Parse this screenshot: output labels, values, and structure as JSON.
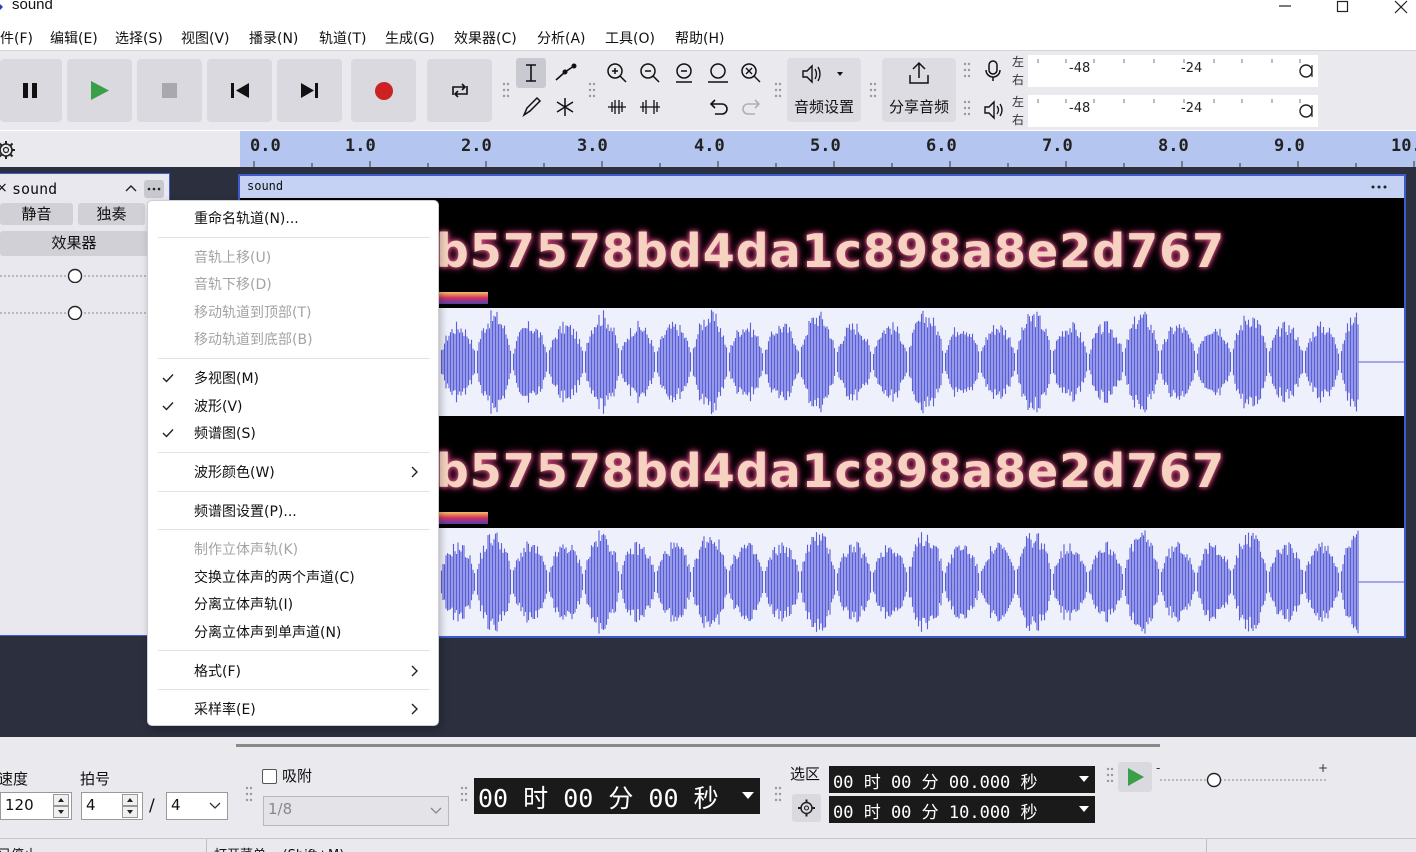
{
  "window": {
    "title": "sound"
  },
  "menu": [
    "件(F)",
    "编辑(E)",
    "选择(S)",
    "视图(V)",
    "播录(N)",
    "轨道(T)",
    "生成(G)",
    "效果器(C)",
    "分析(A)",
    "工具(O)",
    "帮助(H)"
  ],
  "toolbar": {
    "audio_setup_label": "音频设置",
    "share_audio_label": "分享音频",
    "meter_left": "左",
    "meter_right": "右",
    "meter_scale": [
      "-48",
      "-24"
    ]
  },
  "ruler": {
    "ticks": [
      "0.0",
      "1.0",
      "2.0",
      "3.0",
      "4.0",
      "5.0",
      "6.0",
      "7.0",
      "8.0",
      "9.0",
      "10."
    ]
  },
  "track": {
    "name": "sound",
    "mute_label": "静音",
    "solo_label": "独奏",
    "effects_label": "效果器",
    "gain_level": 0.5,
    "pan_level": 0.5
  },
  "clip": {
    "name": "sound",
    "spectrogram_text": "353bb7b57578bd4da1c898a8e2d767"
  },
  "context_menu": {
    "items": [
      {
        "label": "重命名轨道(N)...",
        "enabled": true
      },
      {
        "label": "音轨上移(U)",
        "enabled": false
      },
      {
        "label": "音轨下移(D)",
        "enabled": false
      },
      {
        "label": "移动轨道到顶部(T)",
        "enabled": false
      },
      {
        "label": "移动轨道到底部(B)",
        "enabled": false
      },
      {
        "label": "多视图(M)",
        "enabled": true,
        "checked": true
      },
      {
        "label": "波形(V)",
        "enabled": true,
        "checked": true
      },
      {
        "label": "频谱图(S)",
        "enabled": true,
        "checked": true
      },
      {
        "label": "波形颜色(W)",
        "enabled": true,
        "submenu": true
      },
      {
        "label": "频谱图设置(P)...",
        "enabled": true
      },
      {
        "label": "制作立体声轨(K)",
        "enabled": false
      },
      {
        "label": "交换立体声的两个声道(C)",
        "enabled": true
      },
      {
        "label": "分离立体声轨(I)",
        "enabled": true
      },
      {
        "label": "分离立体声到单声道(N)",
        "enabled": true
      },
      {
        "label": "格式(F)",
        "enabled": true,
        "submenu": true
      },
      {
        "label": "采样率(E)",
        "enabled": true,
        "submenu": true
      }
    ]
  },
  "bottom": {
    "tempo_label": "速度",
    "tempo_value": "120",
    "time_sig_label": "拍号",
    "time_sig_upper": "4",
    "time_sig_lower": "4",
    "snap_label": "吸附",
    "snap_value": "1/8",
    "time_display": "00 时 00 分 00 秒",
    "selection_label": "选区",
    "selection_start": "00 时 00 分 00.000 秒",
    "selection_end": "00 时 00 分 10.000 秒"
  },
  "status": {
    "left_text": "已停止",
    "hint_text": "打开菜单... (Shift+M)"
  },
  "colors": {
    "accent": "#3c5ccc",
    "ruler": "#b4c5f0",
    "waveform": "#5a5ed8",
    "record": "#cc2222",
    "play": "#3aa048"
  }
}
